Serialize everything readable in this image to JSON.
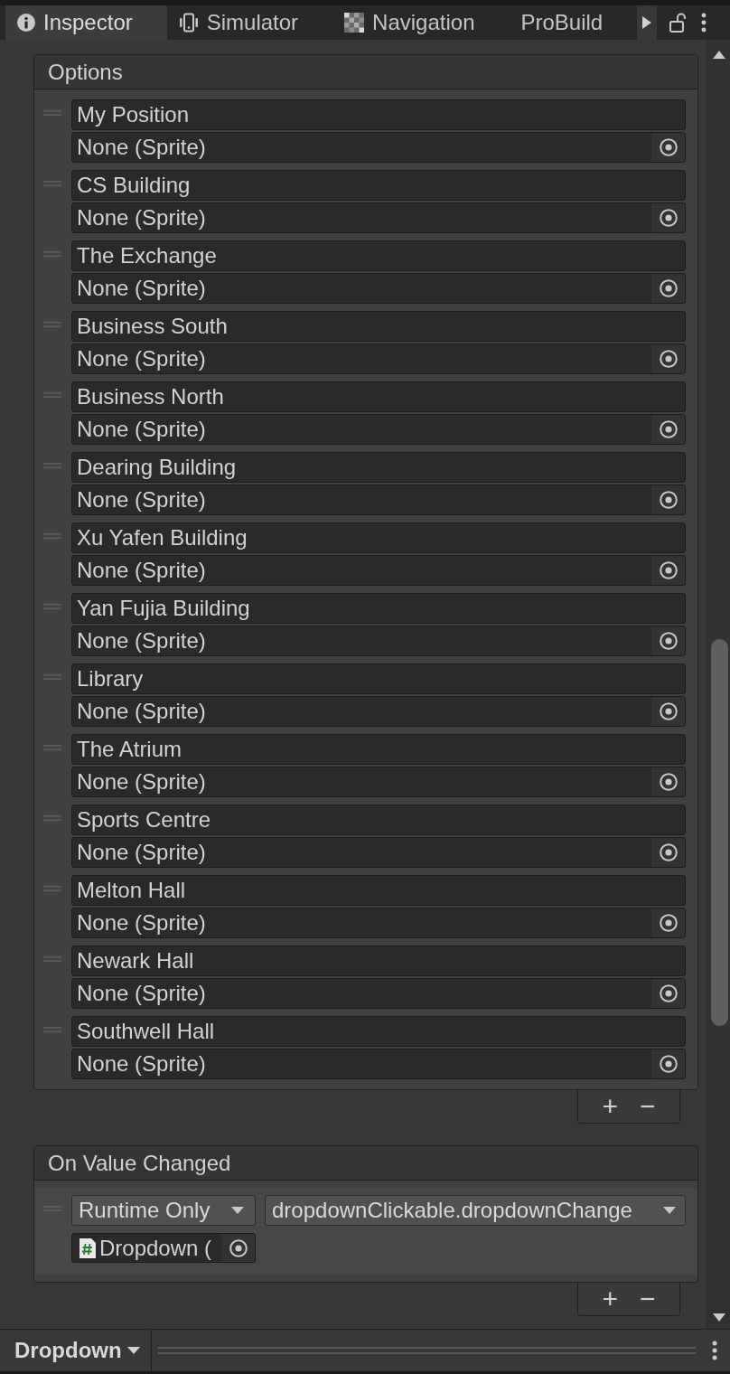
{
  "tabs": [
    {
      "label": "Inspector",
      "kind": "info",
      "selected": true
    },
    {
      "label": "Simulator",
      "kind": "device",
      "selected": false
    },
    {
      "label": "Navigation",
      "kind": "navigation",
      "selected": false
    },
    {
      "label": "ProBuild",
      "kind": "plain",
      "selected": false
    }
  ],
  "options": {
    "title": "Options",
    "items": [
      {
        "label": "My Position",
        "image": "None (Sprite)"
      },
      {
        "label": "CS Building",
        "image": "None (Sprite)"
      },
      {
        "label": "The Exchange",
        "image": "None (Sprite)"
      },
      {
        "label": "Business South",
        "image": "None (Sprite)"
      },
      {
        "label": "Business North",
        "image": "None (Sprite)"
      },
      {
        "label": "Dearing Building",
        "image": "None (Sprite)"
      },
      {
        "label": "Xu Yafen Building",
        "image": "None (Sprite)"
      },
      {
        "label": "Yan Fujia Building",
        "image": "None (Sprite)"
      },
      {
        "label": "Library",
        "image": "None (Sprite)"
      },
      {
        "label": "The Atrium",
        "image": "None (Sprite)"
      },
      {
        "label": "Sports Centre",
        "image": "None (Sprite)"
      },
      {
        "label": "Melton Hall",
        "image": "None (Sprite)"
      },
      {
        "label": "Newark Hall",
        "image": "None (Sprite)"
      },
      {
        "label": "Southwell Hall",
        "image": "None (Sprite)"
      }
    ],
    "buttons": [
      "+",
      "−"
    ]
  },
  "on_value_changed": {
    "title": "On Value Changed",
    "calls": [
      {
        "mode": "Runtime Only",
        "function": "dropdownClickable.dropdownChange",
        "object": "Dropdown ("
      }
    ],
    "buttons": [
      "+",
      "−"
    ]
  },
  "status_bar": {
    "label": "Dropdown"
  }
}
